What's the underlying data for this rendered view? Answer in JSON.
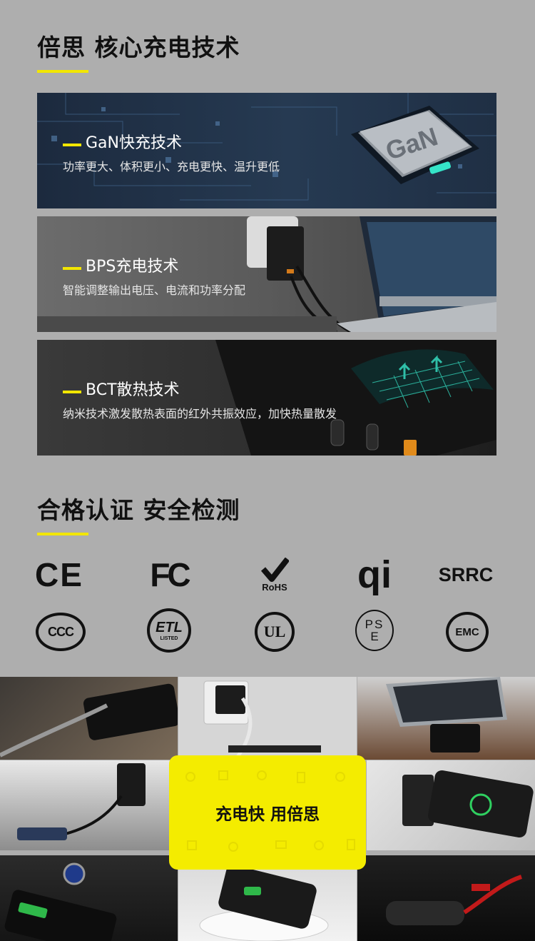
{
  "section1": {
    "title": "倍思 核心充电技术"
  },
  "cards": [
    {
      "heading": "GaN快充技术",
      "sub": "功率更大、体积更小、充电更快、温升更低",
      "chip_text": "GaN"
    },
    {
      "heading": "BPS充电技术",
      "sub": "智能调整输出电压、电流和功率分配"
    },
    {
      "heading": "BCT散热技术",
      "sub": "纳米技术激发散热表面的红外共振效应，加快热量散发"
    }
  ],
  "section2": {
    "title": "合格认证 安全检测"
  },
  "certs": {
    "ce": "CE",
    "fc": "FC",
    "rohs": "RoHS",
    "qi": "qi",
    "srrc": "SRRC",
    "ccc": "CCC",
    "etl": "ETL",
    "etl_listed": "LISTED",
    "ul": "UL",
    "pse_top": "PS",
    "pse_bottom": "E",
    "emc": "EMC"
  },
  "gallery": {
    "slogan": "充电快 用倍思"
  },
  "colors": {
    "accent": "#f2e600",
    "background": "#aeaeae"
  }
}
